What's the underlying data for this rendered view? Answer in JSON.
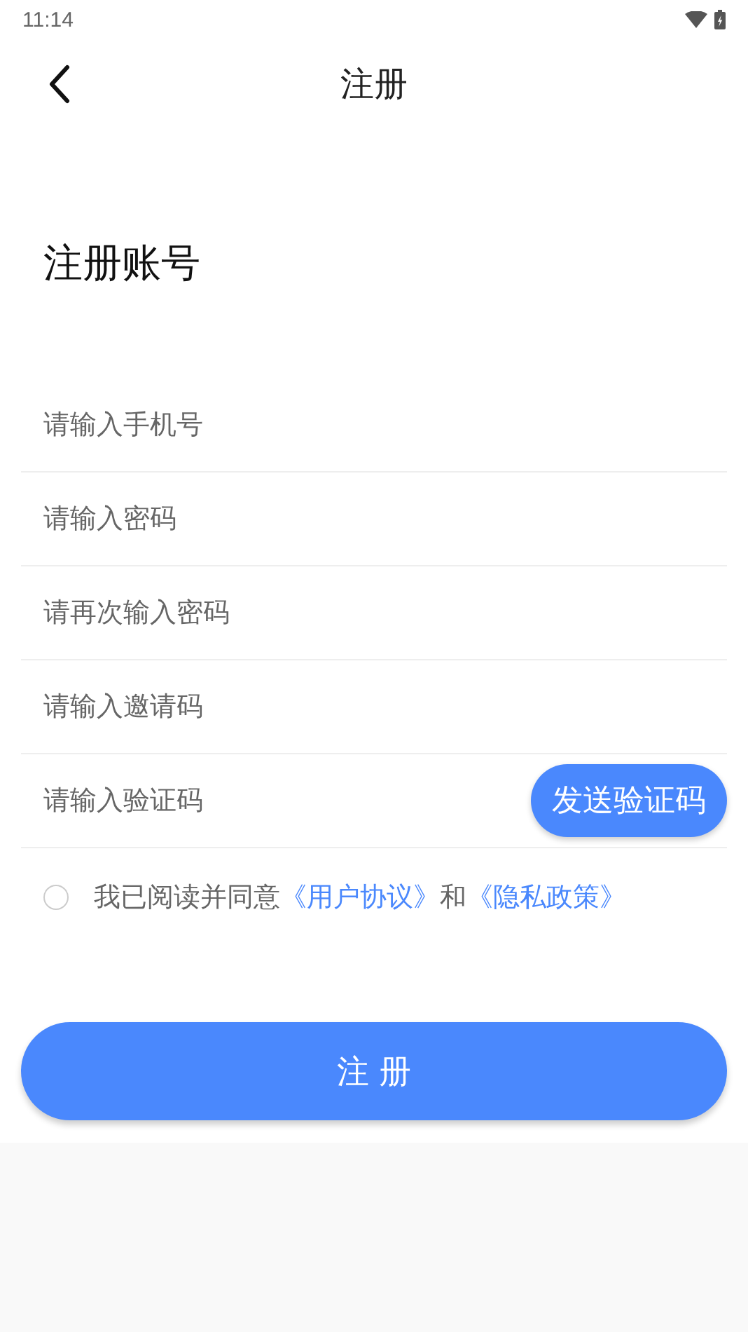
{
  "status_bar": {
    "time": "11:14"
  },
  "header": {
    "title": "注册"
  },
  "heading": "注册账号",
  "fields": [
    {
      "placeholder": "请输入手机号"
    },
    {
      "placeholder": "请输入密码"
    },
    {
      "placeholder": "请再次输入密码"
    },
    {
      "placeholder": "请输入邀请码"
    },
    {
      "placeholder": "请输入验证码",
      "action_button": "发送验证码"
    }
  ],
  "agreement": {
    "checked": false,
    "parts": [
      {
        "kind": "text",
        "text": "我已阅读并同意"
      },
      {
        "kind": "link",
        "text": "《用户协议》"
      },
      {
        "kind": "text",
        "text": "和"
      },
      {
        "kind": "link",
        "text": "《隐私政策》"
      }
    ]
  },
  "submit_button": "注 册"
}
